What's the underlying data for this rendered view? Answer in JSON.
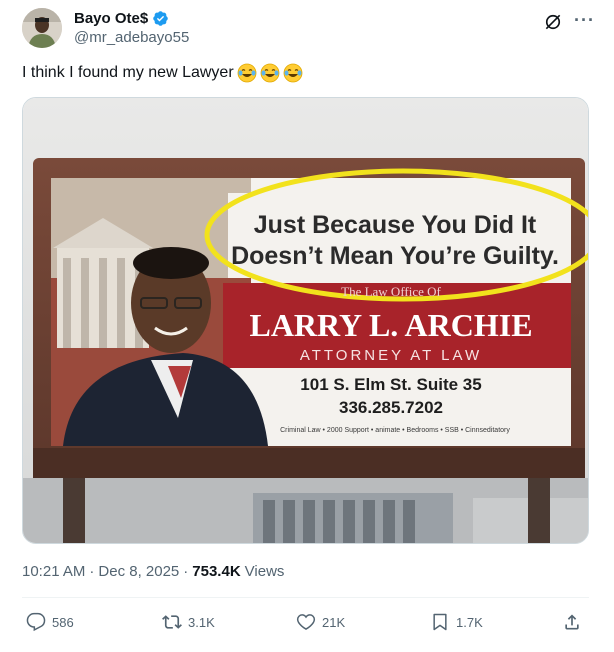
{
  "author": {
    "display_name": "Bayo Ote$",
    "handle": "@mr_adebayo55",
    "verified_color": "#1d9bf0"
  },
  "icons": {
    "grok": "grok-icon",
    "more": "more-icon",
    "verified": "verified-badge-icon"
  },
  "tweet": {
    "text": "I think I found my new Lawyer",
    "emojis": [
      "face-with-tears-of-joy",
      "face-with-tears-of-joy",
      "face-with-tears-of-joy"
    ]
  },
  "billboard": {
    "slogan_line1": "Just Because You Did It",
    "slogan_line2": "Doesn’t Mean You’re Guilty.",
    "office_line": "The Law Office Of",
    "lawyer_name": "LARRY L. ARCHIE",
    "title": "ATTORNEY AT LAW",
    "address": "101 S. Elm St. Suite 35",
    "phone": "336.285.7202",
    "services": "Criminal Law • 2000 Support • animate • Bedrooms • SSB • Cinnseditatory"
  },
  "meta": {
    "time": "10:21 AM",
    "sep1": "·",
    "date": "Dec 8, 2025",
    "sep2": "·",
    "views_count": "753.4K",
    "views_label": "Views"
  },
  "actions": {
    "replies": "586",
    "reposts": "3.1K",
    "likes": "21K",
    "bookmarks": "1.7K"
  },
  "colors": {
    "text_primary": "#0f1419",
    "text_secondary": "#536471",
    "highlight_circle": "#f2e21c",
    "billboard_red": "#a8232a"
  }
}
